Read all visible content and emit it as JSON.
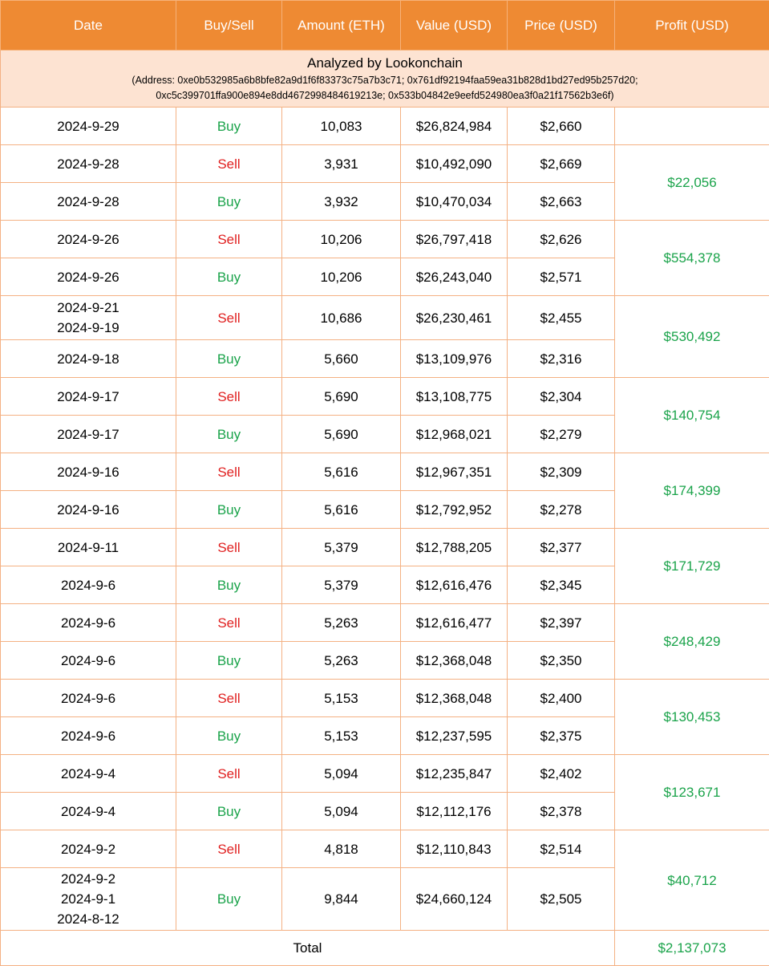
{
  "headers": [
    "Date",
    "Buy/Sell",
    "Amount (ETH)",
    "Value (USD)",
    "Price (USD)",
    "Profit (USD)"
  ],
  "banner": {
    "title": "Analyzed by Lookonchain",
    "address_line1": "(Address: 0xe0b532985a6b8bfe82a9d1f6f83373c75a7b3c71; 0x761df92194faa59ea31b828d1bd27ed95b257d20;",
    "address_line2": "0xc5c399701ffa900e894e8dd4672998484619213e; 0x533b04842e9eefd524980ea3f0a21f17562b3e6f)"
  },
  "rows": [
    {
      "dates": [
        "2024-9-29"
      ],
      "side": "Buy",
      "amount": "10,083",
      "value": "$26,824,984",
      "price": "$2,660"
    },
    {
      "dates": [
        "2024-9-28"
      ],
      "side": "Sell",
      "amount": "3,931",
      "value": "$10,492,090",
      "price": "$2,669"
    },
    {
      "dates": [
        "2024-9-28"
      ],
      "side": "Buy",
      "amount": "3,932",
      "value": "$10,470,034",
      "price": "$2,663"
    },
    {
      "dates": [
        "2024-9-26"
      ],
      "side": "Sell",
      "amount": "10,206",
      "value": "$26,797,418",
      "price": "$2,626"
    },
    {
      "dates": [
        "2024-9-26"
      ],
      "side": "Buy",
      "amount": "10,206",
      "value": "$26,243,040",
      "price": "$2,571"
    },
    {
      "dates": [
        "2024-9-21",
        "2024-9-19"
      ],
      "side": "Sell",
      "amount": "10,686",
      "value": "$26,230,461",
      "price": "$2,455"
    },
    {
      "dates": [
        "2024-9-18"
      ],
      "side": "Buy",
      "amount": "5,660",
      "value": "$13,109,976",
      "price": "$2,316"
    },
    {
      "dates": [
        "2024-9-17"
      ],
      "side": "Sell",
      "amount": "5,690",
      "value": "$13,108,775",
      "price": "$2,304"
    },
    {
      "dates": [
        "2024-9-17"
      ],
      "side": "Buy",
      "amount": "5,690",
      "value": "$12,968,021",
      "price": "$2,279"
    },
    {
      "dates": [
        "2024-9-16"
      ],
      "side": "Sell",
      "amount": "5,616",
      "value": "$12,967,351",
      "price": "$2,309"
    },
    {
      "dates": [
        "2024-9-16"
      ],
      "side": "Buy",
      "amount": "5,616",
      "value": "$12,792,952",
      "price": "$2,278"
    },
    {
      "dates": [
        "2024-9-11"
      ],
      "side": "Sell",
      "amount": "5,379",
      "value": "$12,788,205",
      "price": "$2,377"
    },
    {
      "dates": [
        "2024-9-6"
      ],
      "side": "Buy",
      "amount": "5,379",
      "value": "$12,616,476",
      "price": "$2,345"
    },
    {
      "dates": [
        "2024-9-6"
      ],
      "side": "Sell",
      "amount": "5,263",
      "value": "$12,616,477",
      "price": "$2,397"
    },
    {
      "dates": [
        "2024-9-6"
      ],
      "side": "Buy",
      "amount": "5,263",
      "value": "$12,368,048",
      "price": "$2,350"
    },
    {
      "dates": [
        "2024-9-6"
      ],
      "side": "Sell",
      "amount": "5,153",
      "value": "$12,368,048",
      "price": "$2,400"
    },
    {
      "dates": [
        "2024-9-6"
      ],
      "side": "Buy",
      "amount": "5,153",
      "value": "$12,237,595",
      "price": "$2,375"
    },
    {
      "dates": [
        "2024-9-4"
      ],
      "side": "Sell",
      "amount": "5,094",
      "value": "$12,235,847",
      "price": "$2,402"
    },
    {
      "dates": [
        "2024-9-4"
      ],
      "side": "Buy",
      "amount": "5,094",
      "value": "$12,112,176",
      "price": "$2,378"
    },
    {
      "dates": [
        "2024-9-2"
      ],
      "side": "Sell",
      "amount": "4,818",
      "value": "$12,110,843",
      "price": "$2,514"
    },
    {
      "dates": [
        "2024-9-2",
        "2024-9-1",
        "2024-8-12"
      ],
      "side": "Buy",
      "amount": "9,844",
      "value": "$24,660,124",
      "price": "$2,505"
    }
  ],
  "profits": [
    {
      "value": "",
      "rows": 1
    },
    {
      "value": "$22,056",
      "rows": 2
    },
    {
      "value": "$554,378",
      "rows": 2
    },
    {
      "value": "$530,492",
      "rows": 2
    },
    {
      "value": "$140,754",
      "rows": 2
    },
    {
      "value": "$174,399",
      "rows": 2
    },
    {
      "value": "$171,729",
      "rows": 2
    },
    {
      "value": "$248,429",
      "rows": 2
    },
    {
      "value": "$130,453",
      "rows": 2
    },
    {
      "value": "$123,671",
      "rows": 2
    },
    {
      "value": "$40,712",
      "rows": 2
    }
  ],
  "total": {
    "label": "Total",
    "value": "$2,137,073"
  },
  "colors": {
    "header_bg": "#ee8a33",
    "banner_bg": "#fde3d2",
    "border": "#f4b183",
    "buy": "#1aa34a",
    "sell": "#e02020",
    "profit": "#1aa34a"
  }
}
